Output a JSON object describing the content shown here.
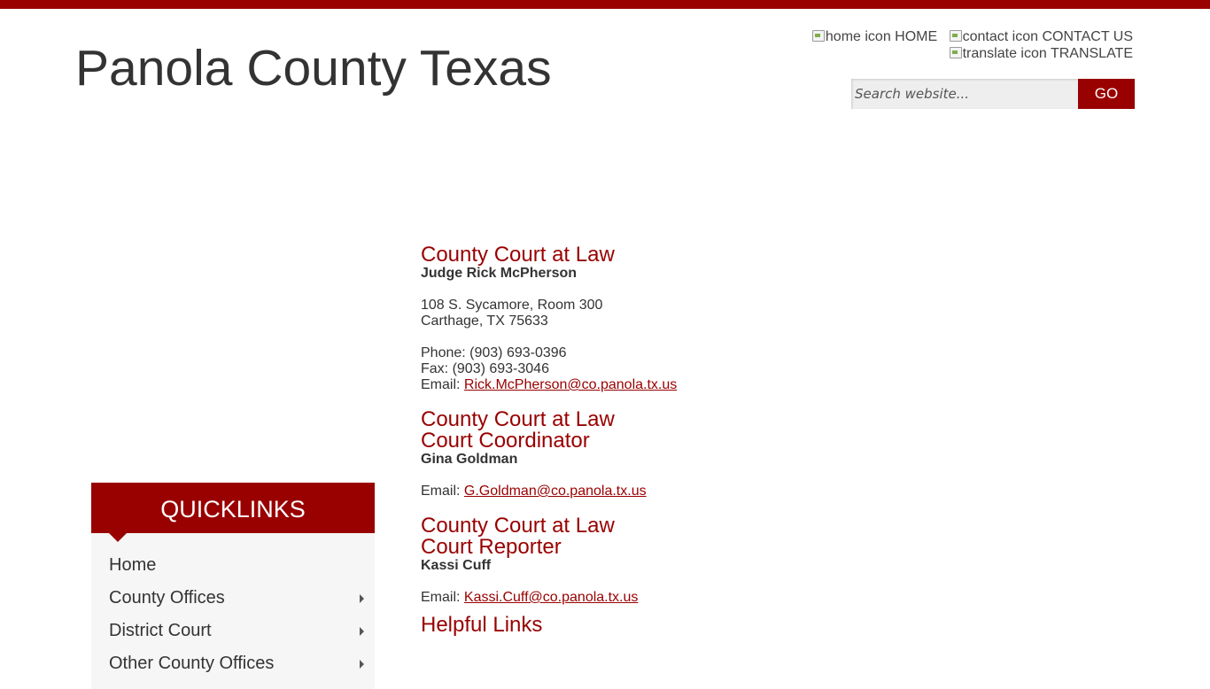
{
  "colors": {
    "brand": "#990000",
    "text": "#333333",
    "panel": "#f6f6f6"
  },
  "site": {
    "title": "Panola County Texas"
  },
  "utility_links": [
    {
      "icon": "home icon",
      "label": "HOME"
    },
    {
      "icon": "contact icon",
      "label": "CONTACT US"
    },
    {
      "icon": "translate icon",
      "label": "TRANSLATE"
    }
  ],
  "search": {
    "placeholder": "Search website...",
    "button_label": "GO"
  },
  "quicklinks": {
    "title": "QUICKLINKS",
    "items": [
      {
        "label": "Home",
        "has_submenu": false
      },
      {
        "label": "County Offices",
        "has_submenu": true
      },
      {
        "label": "District Court",
        "has_submenu": true
      },
      {
        "label": "Other County Offices",
        "has_submenu": true
      }
    ]
  },
  "main": {
    "judge": {
      "title": "County Court at Law",
      "name": "Judge Rick McPherson",
      "address_line1": "108 S. Sycamore, Room 300",
      "address_line2": "Carthage, TX 75633",
      "phone": "Phone: (903) 693-0396",
      "fax": "Fax: (903) 693-3046",
      "email_label": "Email: ",
      "email": "Rick.McPherson@co.panola.tx.us"
    },
    "coordinator": {
      "title_line1": "County Court at Law",
      "title_line2": "Court Coordinator",
      "name": "Gina Goldman",
      "email_label": "Email: ",
      "email": "G.Goldman@co.panola.tx.us"
    },
    "reporter": {
      "title_line1": "County Court at Law",
      "title_line2": "Court Reporter",
      "name": "Kassi Cuff",
      "email_label": "Email: ",
      "email": "Kassi.Cuff@co.panola.tx.us"
    },
    "helpful_links_title": "Helpful Links"
  }
}
